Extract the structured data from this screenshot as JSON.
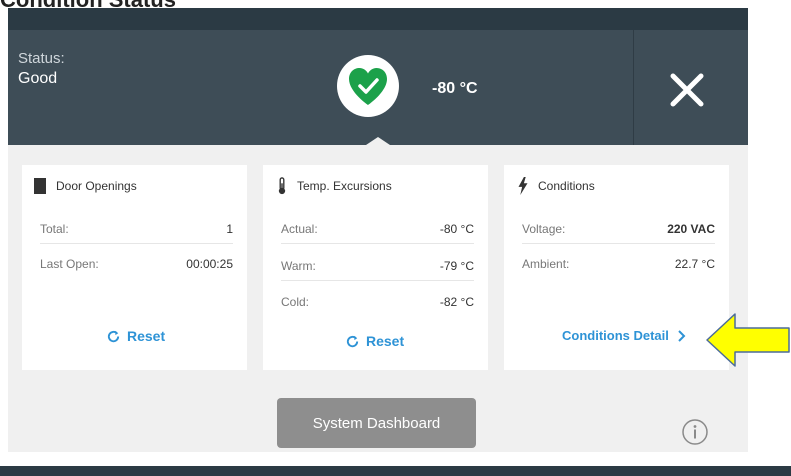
{
  "page": {
    "title": "Condition Status"
  },
  "header": {
    "status_label": "Status:",
    "status_value": "Good",
    "temperature": "-80 °C",
    "status_icon": "heart-check-icon",
    "status_color": "#1ca14a",
    "close_icon": "close-icon"
  },
  "cards": {
    "door": {
      "title": "Door Openings",
      "icon": "door-icon",
      "rows": [
        {
          "label": "Total:",
          "value": "1"
        },
        {
          "label": "Last Open:",
          "value": "00:00:25"
        }
      ],
      "action": "Reset"
    },
    "temp": {
      "title": "Temp. Excursions",
      "icon": "thermometer-icon",
      "rows": [
        {
          "label": "Actual:",
          "value": "-80 °C"
        },
        {
          "label": "Warm:",
          "value": "-79 °C"
        },
        {
          "label": "Cold:",
          "value": "-82 °C"
        }
      ],
      "action": "Reset"
    },
    "conditions": {
      "title": "Conditions",
      "icon": "lightning-icon",
      "rows": [
        {
          "label": "Voltage:",
          "value": "220 VAC"
        },
        {
          "label": "Ambient:",
          "value": "22.7 °C"
        }
      ],
      "action": "Conditions Detail"
    }
  },
  "footer": {
    "dashboard_button": "System Dashboard",
    "info_icon": "info-icon"
  },
  "colors": {
    "header_bg": "#3e4d57",
    "accent_blue": "#2e93d6",
    "callout_yellow": "#ffff00"
  }
}
